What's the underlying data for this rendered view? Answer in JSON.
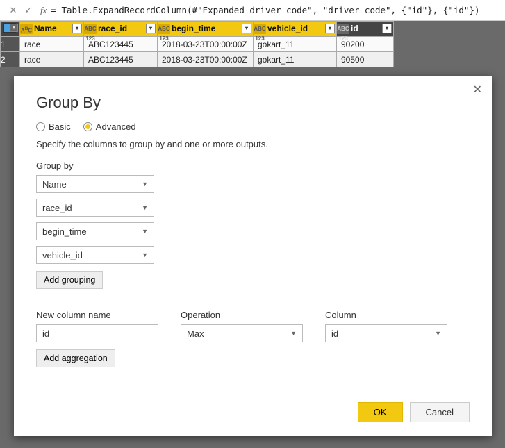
{
  "formula_bar": {
    "fx_label": "fx",
    "text": "= Table.ExpandRecordColumn(#\"Expanded driver_code\", \"driver_code\", {\"id\"}, {\"id\"})"
  },
  "table": {
    "columns": [
      "Name",
      "race_id",
      "begin_time",
      "vehicle_id",
      "id"
    ],
    "type_badges": [
      "ABC",
      "ABC 123",
      "ABC 123",
      "ABC 123",
      "ABC 123"
    ],
    "rows": [
      {
        "n": "1",
        "cells": [
          "race",
          "ABC123445",
          "2018-03-23T00:00:00Z",
          "gokart_11",
          "90200"
        ]
      },
      {
        "n": "2",
        "cells": [
          "race",
          "ABC123445",
          "2018-03-23T00:00:00Z",
          "gokart_11",
          "90500"
        ]
      }
    ]
  },
  "dialog": {
    "title": "Group By",
    "radio_basic": "Basic",
    "radio_advanced": "Advanced",
    "description": "Specify the columns to group by and one or more outputs.",
    "group_by_label": "Group by",
    "group_fields": [
      "Name",
      "race_id",
      "begin_time",
      "vehicle_id"
    ],
    "add_grouping": "Add grouping",
    "new_col_label": "New column name",
    "new_col_value": "id",
    "operation_label": "Operation",
    "operation_value": "Max",
    "column_label": "Column",
    "column_value": "id",
    "add_aggregation": "Add aggregation",
    "ok": "OK",
    "cancel": "Cancel"
  }
}
